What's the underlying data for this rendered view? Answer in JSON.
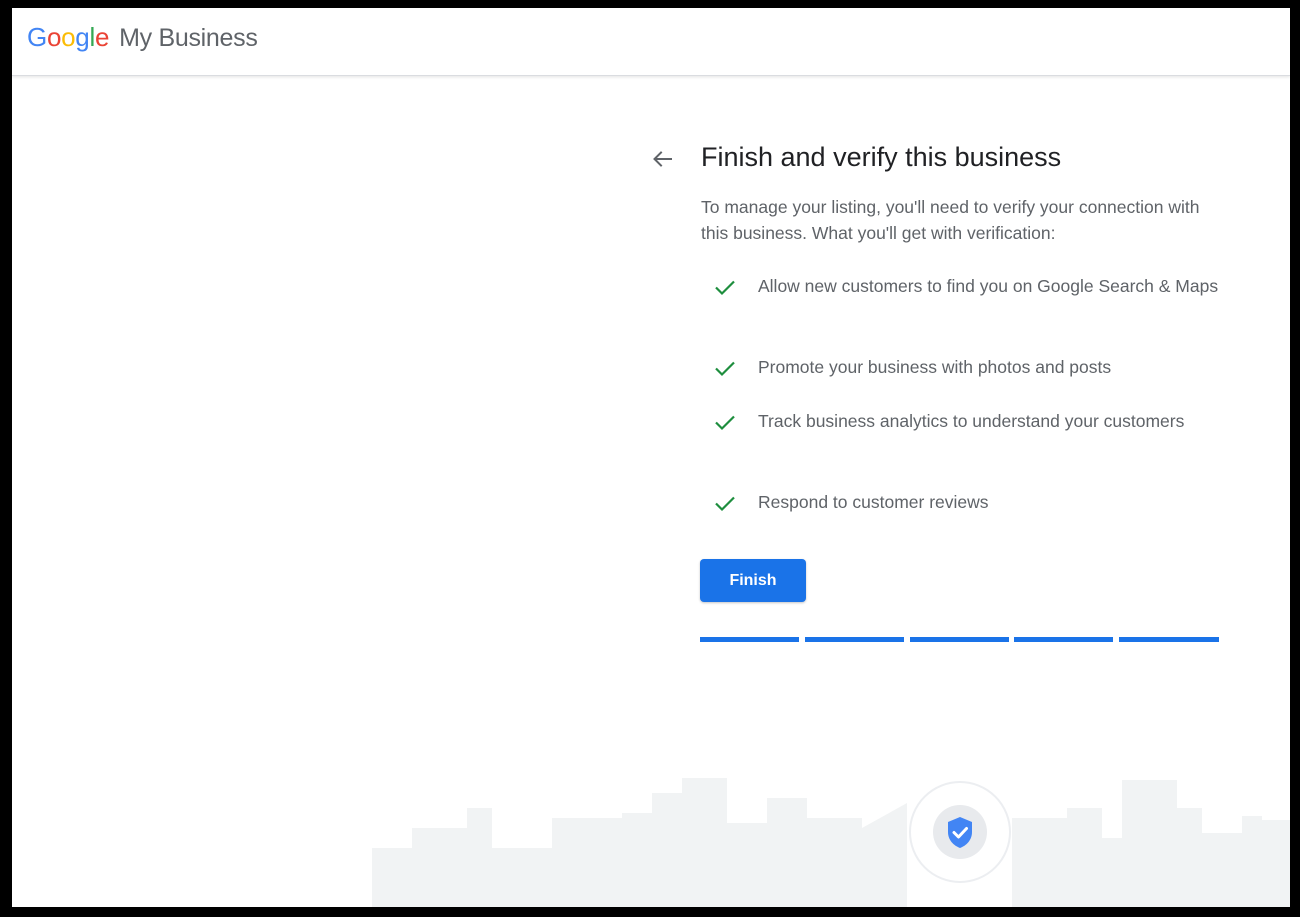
{
  "header": {
    "logo": {
      "letters": [
        "G",
        "o",
        "o",
        "g",
        "l",
        "e"
      ]
    },
    "product_name": "My Business"
  },
  "main": {
    "title": "Finish and verify this business",
    "intro": "To manage your listing, you'll need to verify your connection with this business. What you'll get with verification:",
    "benefits": [
      {
        "text": "Allow new customers to find you on Google Search & Maps",
        "icon": "check-icon"
      },
      {
        "text": "Promote your business with photos and posts",
        "icon": "check-icon"
      },
      {
        "text": "Track business analytics to understand your customers",
        "icon": "check-icon"
      },
      {
        "text": "Respond to customer reviews",
        "icon": "check-icon"
      }
    ],
    "finish_label": "Finish",
    "progress": {
      "completed_steps": 5,
      "total_steps": 5
    }
  },
  "icons": {
    "back": "arrow-back-icon",
    "badge": "verified-shield-icon"
  },
  "colors": {
    "accent": "#1a73e8",
    "check": "#1e8e3e",
    "text_primary": "#202124",
    "text_secondary": "#5f6368",
    "skyline": "#f1f3f4"
  }
}
